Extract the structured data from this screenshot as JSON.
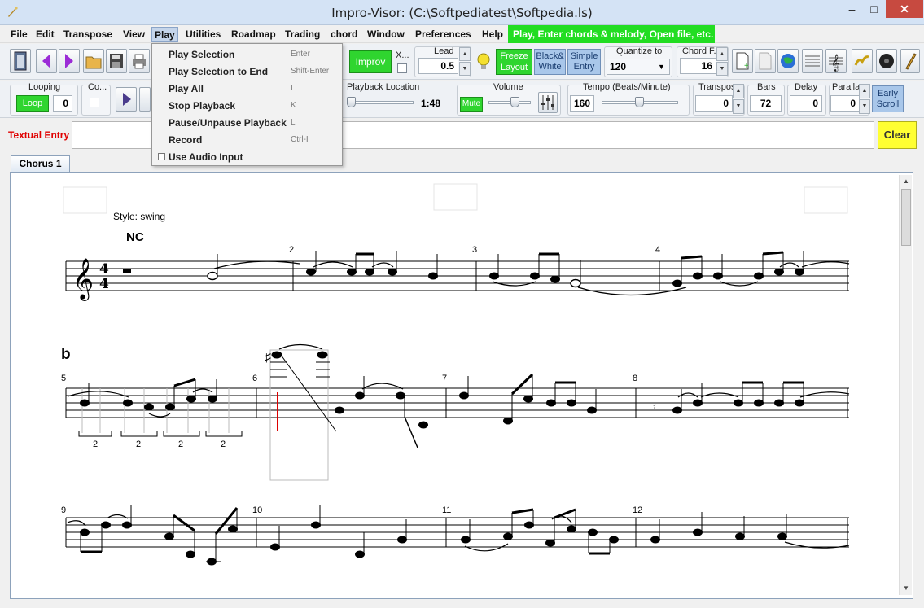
{
  "window": {
    "title": "Impro-Visor: (C:\\Softpediatest\\Softpedia.ls)",
    "minimize": "–",
    "maximize": "□",
    "close": "✕"
  },
  "menu": {
    "items": [
      "File",
      "Edit",
      "Transpose",
      "View",
      "Play",
      "Utilities",
      "Roadmap",
      "Trading",
      "chord",
      "Window",
      "Preferences",
      "Help"
    ],
    "active": "Play",
    "status": "Play, Enter chords & melody, Open file, etc."
  },
  "play_menu": {
    "items": [
      {
        "label": "Play Selection",
        "shortcut": "Enter"
      },
      {
        "label": "Play Selection to End",
        "shortcut": "Shift-Enter"
      },
      {
        "label": "Play All",
        "shortcut": "I"
      },
      {
        "label": "Stop Playback",
        "shortcut": "K"
      },
      {
        "label": "Pause/Unpause Playback",
        "shortcut": "L"
      },
      {
        "label": "Record",
        "shortcut": "Ctrl-I"
      },
      {
        "label": "Use Audio Input",
        "shortcut": ""
      }
    ]
  },
  "toolbar1": {
    "improv_label": "Improv",
    "x_label": "X...",
    "lead_label": "Lead",
    "lead_value": "0.5",
    "freeze_label": "Freeze Layout",
    "black_white_label": "Black& White",
    "simple_entry_label": "Simple Entry",
    "quantize_label": "Quantize to",
    "quantize_value": "120",
    "chord_font_label": "Chord F...",
    "chord_font_value": "16"
  },
  "toolbar2": {
    "looping_label": "Looping",
    "loop_button": "Loop",
    "loop_count": "0",
    "co_label": "Co...",
    "playback_location_label": "Playback Location",
    "playback_time": "1:48",
    "volume_label": "Volume",
    "mute_label": "Mute",
    "tempo_label": "Tempo (Beats/Minute)",
    "tempo_value": "160",
    "transpose_label": "Transpos...",
    "transpose_value": "0",
    "bars_label": "Bars",
    "bars_value": "72",
    "delay_label": "Delay",
    "delay_value": "0",
    "parallax_label": "Paralla...",
    "parallax_value": "0",
    "early_scroll_label": "Early Scroll"
  },
  "textual_entry": {
    "label": "Textual Entry",
    "value": "",
    "clear_label": "Clear"
  },
  "tabs": [
    "Chorus 1"
  ],
  "score": {
    "style_text": "Style: swing",
    "first_chord": "NC",
    "second_chord": "b",
    "time_signature": [
      "4",
      "4"
    ],
    "measure_numbers": [
      "2",
      "3",
      "4",
      "5",
      "6",
      "7",
      "8",
      "9",
      "10",
      "11",
      "12"
    ],
    "tuplet_labels": [
      "2",
      "2",
      "2",
      "2"
    ]
  }
}
